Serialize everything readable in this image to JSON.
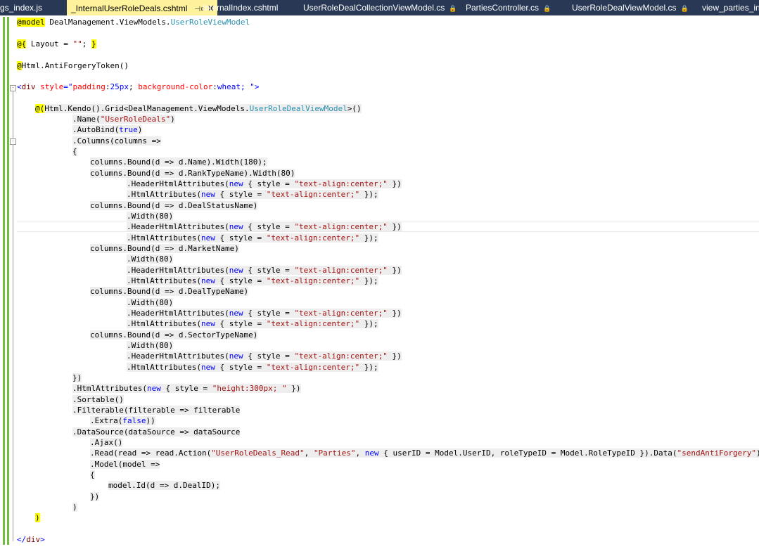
{
  "tabs": [
    {
      "label": "gs_index.js",
      "lock": ""
    },
    {
      "label": "_InternalUserRoleDeals.cshtml",
      "pin": "⊣¤",
      "close": "✕"
    },
    {
      "label": "InternalIndex.cshtml",
      "lock": ""
    },
    {
      "label": "UserRoleDealCollectionViewModel.cs",
      "lock": "🔒"
    },
    {
      "label": "PartiesController.cs",
      "lock": "🔒"
    },
    {
      "label": "UserRoleDealViewModel.cs",
      "lock": "🔒"
    },
    {
      "label": "view_parties_inte",
      "lock": ""
    }
  ],
  "code": {
    "l1": {
      "a": "@model",
      "b": " DealManagement.ViewModels.",
      "c": "UserRoleViewModel"
    },
    "l3": {
      "a": "@{",
      "b": " Layout = ",
      "c": "\"\"",
      "d": "; ",
      "e": "}"
    },
    "l5": {
      "a": "@",
      "b": "Html.AntiForgeryToken()"
    },
    "l7": {
      "a": "<",
      "b": "div",
      "c": " style",
      "d": "=\"",
      "e": "padding",
      "f": ":",
      "g": "25px",
      "h": "; ",
      "i": "background-color",
      "j": ":",
      "k": "wheat",
      "l": "; \">"
    },
    "l9": {
      "a": "@(",
      "b": "Html.Kendo().Grid<DealManagement.ViewModels.",
      "c": "UserRoleDealViewModel",
      "d": ">()"
    },
    "l10": {
      "a": ".Name(",
      "b": "\"UserRoleDeals\"",
      "c": ")"
    },
    "l11": {
      "a": ".AutoBind(",
      "b": "true",
      "c": ")"
    },
    "l12": {
      "a": ".Columns(columns =>"
    },
    "l13": {
      "a": "{"
    },
    "l14": {
      "a": "columns.Bound(d => d.Name).Width(180);"
    },
    "l15": {
      "a": "columns.Bound(d => d.RankTypeName).Width(80)"
    },
    "hha": {
      "a": ".HeaderHtmlAttributes(",
      "b": "new",
      "c": " { style = ",
      "d": "\"text-align:center;\"",
      "e": " })"
    },
    "ha": {
      "a": ".HtmlAttributes(",
      "b": "new",
      "c": " { style = ",
      "d": "\"text-align:center;\"",
      "e": " });"
    },
    "w80": {
      "a": ".Width(80)"
    },
    "l18": {
      "a": "columns.Bound(d => d.DealStatusName)"
    },
    "l22": {
      "a": "columns.Bound(d => d.MarketName)"
    },
    "l26": {
      "a": "columns.Bound(d => d.DealTypeName)"
    },
    "l30": {
      "a": "columns.Bound(d => d.SectorTypeName)"
    },
    "l34": {
      "a": "})"
    },
    "l35": {
      "a": ".HtmlAttributes(",
      "b": "new",
      "c": " { style = ",
      "d": "\"height:300px; \"",
      "e": " })"
    },
    "l36": {
      "a": ".Sortable()"
    },
    "l37": {
      "a": ".Filterable(filterable => filterable"
    },
    "l38": {
      "a": ".Extra(",
      "b": "false",
      "c": "))"
    },
    "l39": {
      "a": ".DataSource(dataSource => dataSource"
    },
    "l40": {
      "a": ".Ajax()"
    },
    "l41": {
      "a": ".Read(read => read.Action(",
      "b": "\"UserRoleDeals_Read\"",
      "c": ", ",
      "d": "\"Parties\"",
      "e": ", ",
      "f": "new",
      "g": " { userID = Model.UserID, roleTypeID = Model.RoleTypeID }).Data(",
      "h": "\"sendAntiForgery\"",
      "i": "))"
    },
    "l42": {
      "a": ".Model(model =>"
    },
    "l43": {
      "a": "{"
    },
    "l44": {
      "a": "model.Id(d => d.DealID);"
    },
    "l45": {
      "a": "})"
    },
    "l46": {
      "a": ")"
    },
    "l47": {
      "a": ")"
    },
    "l49": {
      "a": "</",
      "b": "div",
      "c": ">"
    }
  }
}
